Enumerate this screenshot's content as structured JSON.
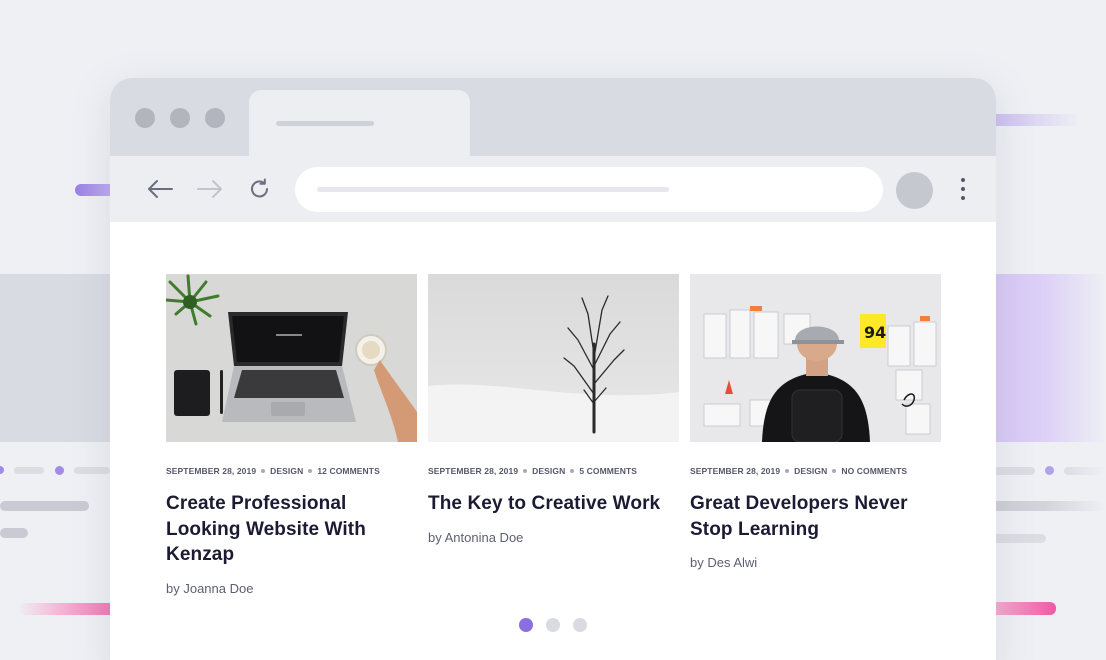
{
  "colors": {
    "accent": "#8a6fdf",
    "pink": "#ef5fa7",
    "chrome": "#d9dbe3",
    "text": "#1c1b33"
  },
  "browser": {
    "icons": {
      "back": "arrow-left-icon",
      "forward": "arrow-right-icon",
      "reload": "reload-icon",
      "menu": "more-vertical-icon"
    }
  },
  "posts": [
    {
      "date": "SEPTEMBER 28, 2019",
      "category": "DESIGN",
      "comments": "12 COMMENTS",
      "title": "Create Professional Looking Website With Kenzap",
      "author": "by Joanna Doe",
      "image": "laptop-desk-image"
    },
    {
      "date": "SEPTEMBER 28, 2019",
      "category": "DESIGN",
      "comments": "5 COMMENTS",
      "title": "The Key to Creative Work",
      "author": "by Antonina Doe",
      "image": "winter-tree-image"
    },
    {
      "date": "SEPTEMBER 28, 2019",
      "category": "DESIGN",
      "comments": "NO COMMENTS",
      "title": "Great Developers Never Stop Learning",
      "author": "by Des Alwi",
      "image": "developer-wall-image"
    }
  ],
  "pagination": {
    "pages": 3,
    "active": 1
  }
}
